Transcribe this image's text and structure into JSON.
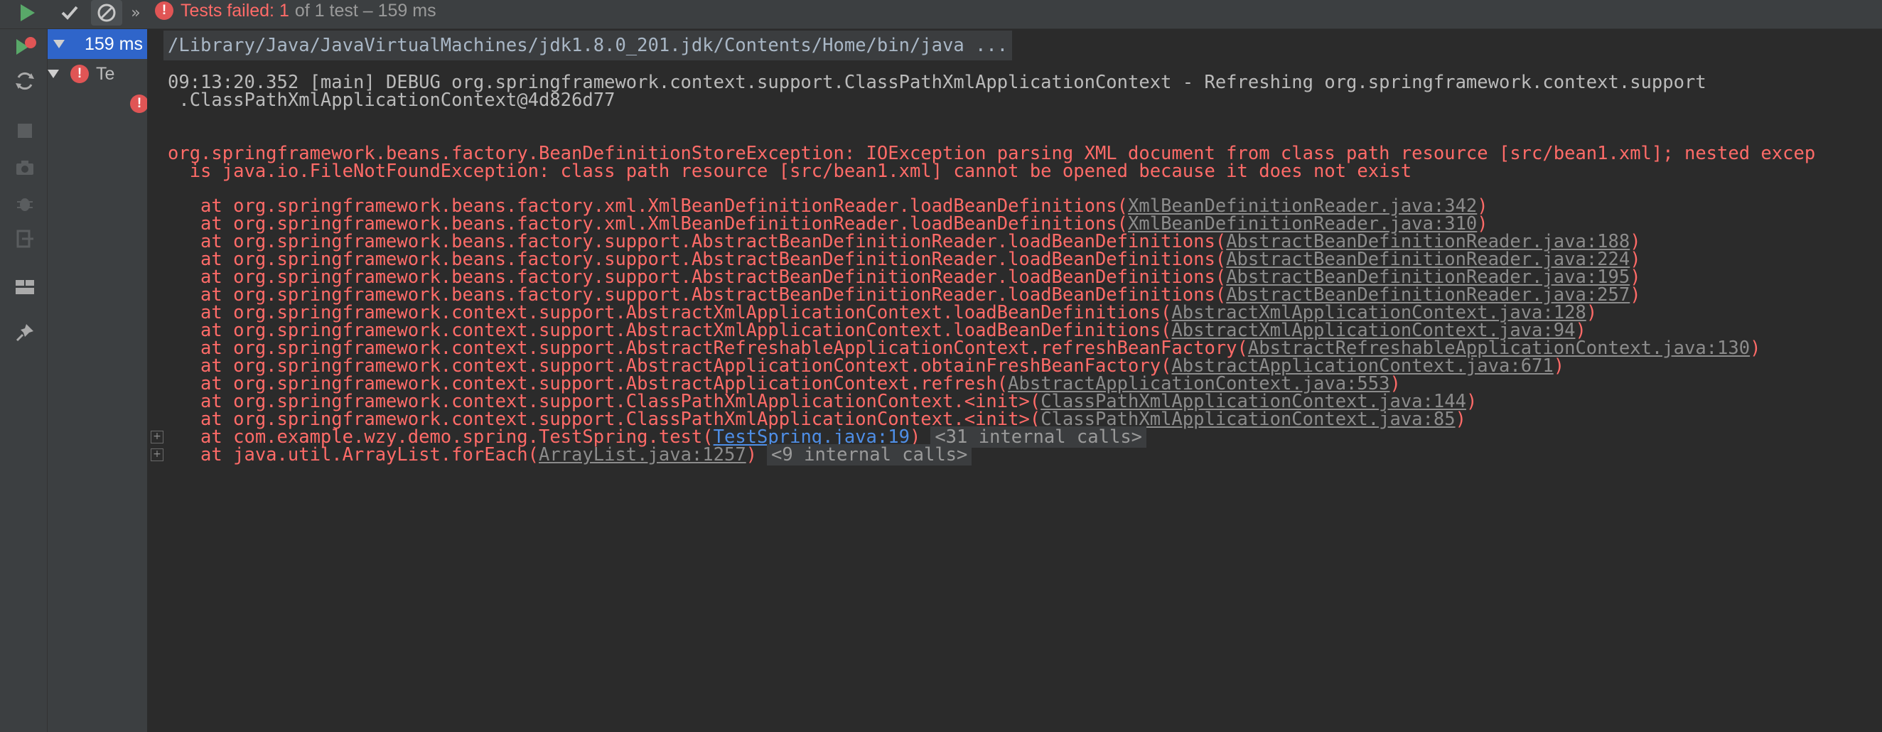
{
  "toolbar": {
    "status_failed": "Tests failed: 1",
    "status_rest": "of 1 test – 159 ms"
  },
  "tree": {
    "root_time": "159 ms",
    "child_label": "Te"
  },
  "console": {
    "command": "/Library/Java/JavaVirtualMachines/jdk1.8.0_201.jdk/Contents/Home/bin/java ...",
    "log_line1": "09:13:20.352 [main] DEBUG org.springframework.context.support.ClassPathXmlApplicationContext - Refreshing org.springframework.context.support",
    "log_line2": " .ClassPathXmlApplicationContext@4d826d77",
    "exception_line1": "org.springframework.beans.factory.BeanDefinitionStoreException: IOException parsing XML document from class path resource [src/bean1.xml]; nested excep",
    "exception_line2": "  is java.io.FileNotFoundException: class path resource [src/bean1.xml] cannot be opened because it does not exist",
    "frames": [
      {
        "prefix": "   at org.springframework.beans.factory.xml.XmlBeanDefinitionReader.loadBeanDefinitions(",
        "link": "XmlBeanDefinitionReader.java:342",
        "suffix": ")"
      },
      {
        "prefix": "   at org.springframework.beans.factory.xml.XmlBeanDefinitionReader.loadBeanDefinitions(",
        "link": "XmlBeanDefinitionReader.java:310",
        "suffix": ")"
      },
      {
        "prefix": "   at org.springframework.beans.factory.support.AbstractBeanDefinitionReader.loadBeanDefinitions(",
        "link": "AbstractBeanDefinitionReader.java:188",
        "suffix": ")"
      },
      {
        "prefix": "   at org.springframework.beans.factory.support.AbstractBeanDefinitionReader.loadBeanDefinitions(",
        "link": "AbstractBeanDefinitionReader.java:224",
        "suffix": ")"
      },
      {
        "prefix": "   at org.springframework.beans.factory.support.AbstractBeanDefinitionReader.loadBeanDefinitions(",
        "link": "AbstractBeanDefinitionReader.java:195",
        "suffix": ")"
      },
      {
        "prefix": "   at org.springframework.beans.factory.support.AbstractBeanDefinitionReader.loadBeanDefinitions(",
        "link": "AbstractBeanDefinitionReader.java:257",
        "suffix": ")"
      },
      {
        "prefix": "   at org.springframework.context.support.AbstractXmlApplicationContext.loadBeanDefinitions(",
        "link": "AbstractXmlApplicationContext.java:128",
        "suffix": ")"
      },
      {
        "prefix": "   at org.springframework.context.support.AbstractXmlApplicationContext.loadBeanDefinitions(",
        "link": "AbstractXmlApplicationContext.java:94",
        "suffix": ")"
      },
      {
        "prefix": "   at org.springframework.context.support.AbstractRefreshableApplicationContext.refreshBeanFactory(",
        "link": "AbstractRefreshableApplicationContext.java:130",
        "suffix": ")"
      },
      {
        "prefix": "   at org.springframework.context.support.AbstractApplicationContext.obtainFreshBeanFactory(",
        "link": "AbstractApplicationContext.java:671",
        "suffix": ")"
      },
      {
        "prefix": "   at org.springframework.context.support.AbstractApplicationContext.refresh(",
        "link": "AbstractApplicationContext.java:553",
        "suffix": ")"
      },
      {
        "prefix": "   at org.springframework.context.support.ClassPathXmlApplicationContext.<init>(",
        "link": "ClassPathXmlApplicationContext.java:144",
        "suffix": ")"
      },
      {
        "prefix": "   at org.springframework.context.support.ClassPathXmlApplicationContext.<init>(",
        "link": "ClassPathXmlApplicationContext.java:85",
        "suffix": ")"
      },
      {
        "prefix": "   at com.example.wzy.demo.spring.TestSpring.test(",
        "link": "TestSpring.java:19",
        "suffix": ")",
        "internal": "<31 internal calls>",
        "blue": true
      },
      {
        "prefix": "   at java.util.ArrayList.forEach(",
        "link": "ArrayList.java:1257",
        "suffix": ")",
        "internal": "<9 internal calls>"
      }
    ]
  },
  "colors": {
    "error": "#ff6b68",
    "selection": "#2f65ca",
    "link_blue": "#4e8ee6"
  }
}
